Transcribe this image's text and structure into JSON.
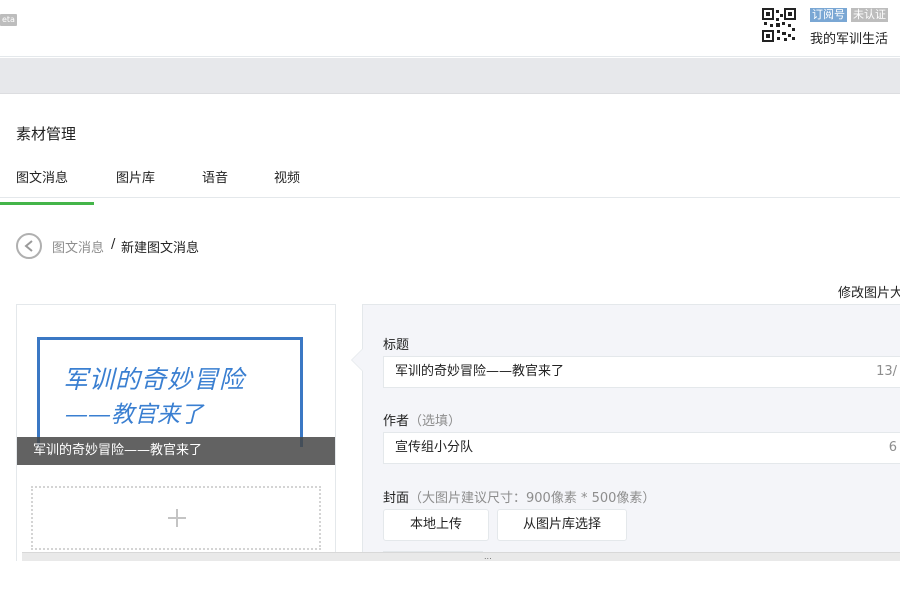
{
  "header": {
    "beta_badge": "eta",
    "qr_icon": "qr-code-icon",
    "tag_subscription": "订阅号",
    "tag_unverified": "未认证",
    "account_name": "我的军训生活"
  },
  "page": {
    "title": "素材管理",
    "tabs": [
      {
        "label": "图文消息",
        "active": true
      },
      {
        "label": "图片库",
        "active": false
      },
      {
        "label": "语音",
        "active": false
      },
      {
        "label": "视频",
        "active": false
      }
    ],
    "accent_color": "#44b549"
  },
  "breadcrumb": {
    "back_icon": "back-arrow-icon",
    "parent": "图文消息",
    "separator": "/",
    "current": "新建图文消息"
  },
  "toolbar": {
    "modify_image": "修改图片大"
  },
  "preview": {
    "cover_line1": "军训的奇妙冒险",
    "cover_line2": "——教官来了",
    "caption": "军训的奇妙冒险——教官来了",
    "add_icon": "plus-icon"
  },
  "editor": {
    "title_label": "标题",
    "title_value": "军训的奇妙冒险——教官来了",
    "title_counter": "13/",
    "author_label": "作者",
    "author_hint": "（选填）",
    "author_value": "宣传组小分队",
    "author_counter": "6",
    "cover_label": "封面",
    "cover_hint": "（大图片建议尺寸：900像素 * 500像素）",
    "upload_local": "本地上传",
    "choose_library": "从图片库选择"
  },
  "scrollbar": {
    "grip": "..."
  }
}
